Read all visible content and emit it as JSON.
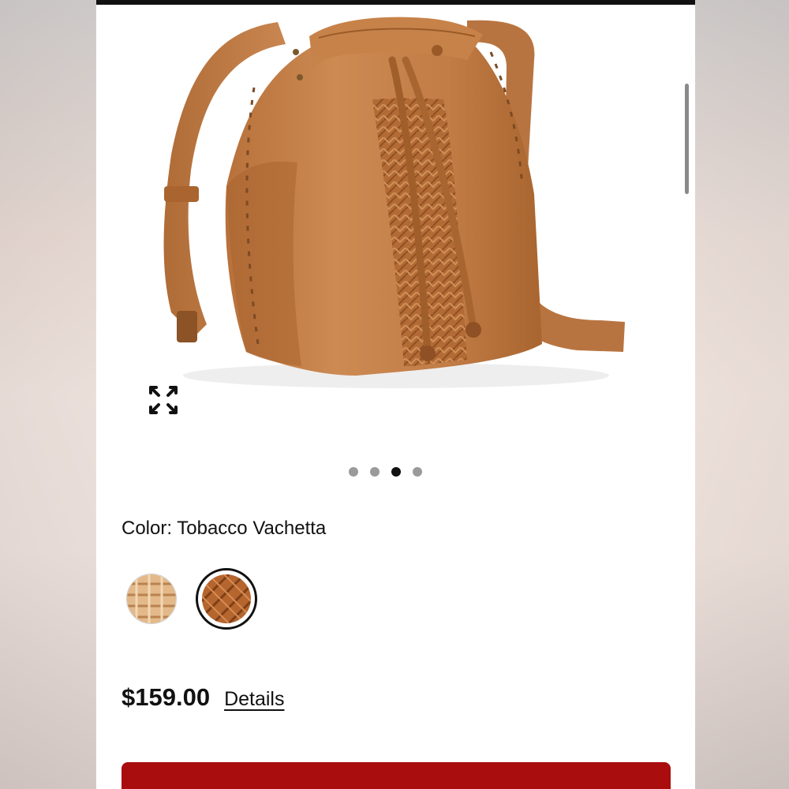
{
  "product": {
    "image_alt": "Tan leather bucket bag with woven panel and drawstring",
    "carousel": {
      "total": 4,
      "active_index": 2
    },
    "color_label": "Color:",
    "color_value": "Tobacco Vachetta",
    "swatches": [
      {
        "name": "Natural woven",
        "color": "#d9a978",
        "selected": false
      },
      {
        "name": "Tobacco Vachetta",
        "color": "#b5652e",
        "selected": true
      }
    ],
    "price": "$159.00",
    "details_link": "Details"
  },
  "colors": {
    "accent_red": "#a90d0d",
    "leather": "#c07a44",
    "text": "#111111"
  },
  "icons": {
    "zoom": "expand-arrows-icon"
  }
}
